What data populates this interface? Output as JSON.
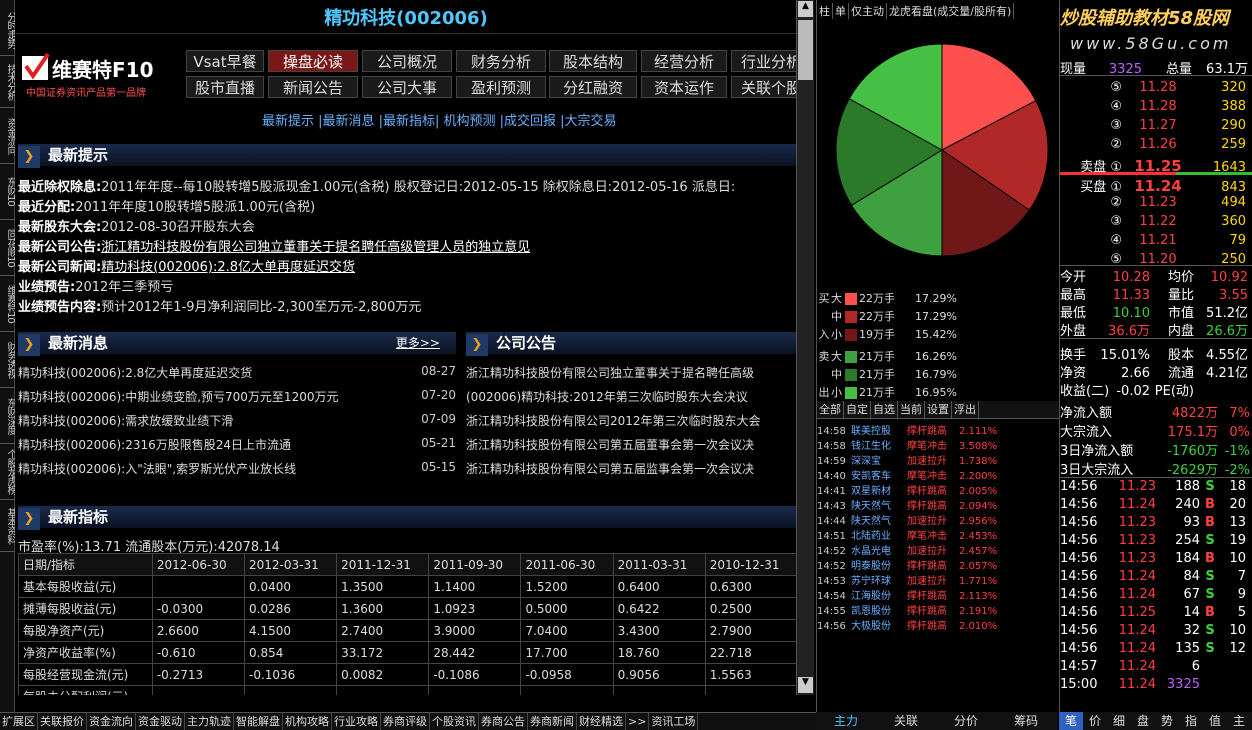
{
  "left_tabs": [
    "分时走势",
    "技术分析",
    "资金流向",
    "东财10",
    "同花顺10",
    "维赛特10",
    "财务透视",
    "东财深度",
    "个股龙虎榜",
    "基本资料"
  ],
  "title": "精功科技(002006)",
  "logo": {
    "name": "维赛特F10",
    "tagline": "中国证券资讯产品第一品牌"
  },
  "nav_row1": [
    "Vsat早餐",
    "操盘必读",
    "公司概况",
    "财务分析",
    "股本结构",
    "经营分析",
    "行业分析"
  ],
  "nav_row2": [
    "股市直播",
    "新闻公告",
    "公司大事",
    "盈利预测",
    "分红融资",
    "资本运作",
    "关联个股"
  ],
  "sublinks": "最新提示 |最新消息 |最新指标| 机构预测 |成交回报 |大宗交易",
  "sec_tips": "最新提示",
  "tips": [
    {
      "k": "最近除权除息:",
      "v": "2011年年度--每10股转增5股派现金1.00元(含税) 股权登记日:2012-05-15 除权除息日:2012-05-16 派息日:"
    },
    {
      "k": "最近分配:",
      "v": "2011年年度10股转增5股派1.00元(含税)"
    },
    {
      "k": "最新股东大会:",
      "v": "2012-08-30召开股东大会"
    },
    {
      "k": "最新公司公告:",
      "v": "浙江精功科技股份有限公司独立董事关于提名聘任高级管理人员的独立意见"
    },
    {
      "k": "最新公司新闻:",
      "v": "精功科技(002006):2.8亿大单再度延迟交货"
    },
    {
      "k": "业绩预告:",
      "v": "2012年三季预亏"
    },
    {
      "k": "业绩预告内容:",
      "v": "预计2012年1-9月净利润同比-2,300至万元-2,800万元"
    }
  ],
  "sec_news": "最新消息",
  "more": "更多>>",
  "sec_ann": "公司公告",
  "news": [
    {
      "t": "精功科技(002006):2.8亿大单再度延迟交货",
      "d": "08-27"
    },
    {
      "t": "精功科技(002006):中期业绩变脸,预亏700万元至1200万元",
      "d": "07-20"
    },
    {
      "t": "精功科技(002006):需求放缓致业绩下滑",
      "d": "07-09"
    },
    {
      "t": "精功科技(002006):2316万股限售股24日上市流通",
      "d": "05-21"
    },
    {
      "t": "精功科技(002006):入\"法眼\",索罗斯光伏产业放长线",
      "d": "05-15"
    }
  ],
  "announcements": [
    "浙江精功科技股份有限公司独立董事关于提名聘任高级",
    "(002006)精功科技:2012年第三次临时股东大会决议",
    "浙江精功科技股份有限公司2012年第三次临时股东大会",
    "浙江精功科技股份有限公司第五届董事会第一次会议决",
    "浙江精功科技股份有限公司第五届监事会第一次会议决"
  ],
  "sec_ind": "最新指标",
  "ind_summary": "市盈率(%):13.71  流通股本(万元):42078.14",
  "ind_header": [
    "日期/指标",
    "2012-06-30",
    "2012-03-31",
    "2011-12-31",
    "2011-09-30",
    "2011-06-30",
    "2011-03-31",
    "2010-12-31"
  ],
  "ind_rows": [
    [
      "基本每股收益(元)",
      "",
      "0.0400",
      "1.3500",
      "1.1400",
      "1.5200",
      "0.6400",
      "0.6300"
    ],
    [
      "摊薄每股收益(元)",
      "-0.0300",
      "0.0286",
      "1.3600",
      "1.0923",
      "0.5000",
      "0.6422",
      "0.2500"
    ],
    [
      "每股净资产(元)",
      "2.6600",
      "4.1500",
      "2.7400",
      "3.9000",
      "7.0400",
      "3.4300",
      "2.7900"
    ],
    [
      "净资产收益率(%)",
      "-0.610",
      "0.854",
      "33.172",
      "28.442",
      "17.700",
      "18.760",
      "22.718"
    ],
    [
      "每股经营现金流(元)",
      "-0.2713",
      "-0.1036",
      "0.0082",
      "-0.1086",
      "-0.0958",
      "0.9056",
      "1.5563"
    ],
    [
      "每股未分配利润(元)",
      "",
      "",
      "",
      "",
      "",
      "",
      ""
    ]
  ],
  "mid_tabs": [
    "柱",
    "单",
    "仅主动",
    "龙虎看盘(成交量/股所有)"
  ],
  "pie": {
    "slices": [
      {
        "label": "买大",
        "pct": 17.29,
        "color": "#ff5050"
      },
      {
        "label": "买中",
        "pct": 17.29,
        "color": "#b02828"
      },
      {
        "label": "买小",
        "pct": 15.42,
        "color": "#701818"
      },
      {
        "label": "卖大",
        "pct": 16.26,
        "color": "#3fa03f"
      },
      {
        "label": "卖中",
        "pct": 16.79,
        "color": "#2a7a2a"
      },
      {
        "label": "卖小",
        "pct": 16.95,
        "color": "#45c045"
      }
    ]
  },
  "fund_flow": [
    {
      "side": "买",
      "size": "大",
      "val": "22万手",
      "pct": "17.29%",
      "color": "#ff5050"
    },
    {
      "side": "",
      "size": "中",
      "val": "22万手",
      "pct": "17.29%",
      "color": "#b02828"
    },
    {
      "side": "入",
      "size": "小",
      "val": "19万手",
      "pct": "15.42%",
      "color": "#701818"
    },
    {
      "side": "卖",
      "size": "大",
      "val": "21万手",
      "pct": "16.26%",
      "color": "#3fa03f"
    },
    {
      "side": "",
      "size": "中",
      "val": "21万手",
      "pct": "16.79%",
      "color": "#2a7a2a"
    },
    {
      "side": "出",
      "size": "小",
      "val": "21万手",
      "pct": "16.95%",
      "color": "#45c045"
    }
  ],
  "list_tabs": [
    "全部",
    "自定",
    "自选",
    "当前",
    "设置",
    "浮出"
  ],
  "list": [
    {
      "t": "14:58",
      "n": "联美控股",
      "e": "撑杆跳高",
      "p": "2.111%"
    },
    {
      "t": "14:58",
      "n": "钱江生化",
      "e": "摩笔冲击",
      "p": "3.508%"
    },
    {
      "t": "14:59",
      "n": "深深宝",
      "e": "加速拉升",
      "p": "1.738%"
    },
    {
      "t": "14:40",
      "n": "安凯客车",
      "e": "摩笔冲击",
      "p": "2.200%"
    },
    {
      "t": "14:41",
      "n": "双星新材",
      "e": "撑杆跳高",
      "p": "2.005%"
    },
    {
      "t": "14:43",
      "n": "陕天然气",
      "e": "撑杆跳高",
      "p": "2.094%"
    },
    {
      "t": "14:44",
      "n": "陕天然气",
      "e": "加速拉升",
      "p": "2.956%"
    },
    {
      "t": "14:51",
      "n": "北陆药业",
      "e": "摩笔冲击",
      "p": "2.453%"
    },
    {
      "t": "14:52",
      "n": "水晶光电",
      "e": "加速拉升",
      "p": "2.457%"
    },
    {
      "t": "14:52",
      "n": "明泰股份",
      "e": "撑杆跳高",
      "p": "2.057%"
    },
    {
      "t": "14:53",
      "n": "苏宁环球",
      "e": "加速拉升",
      "p": "1.771%"
    },
    {
      "t": "14:54",
      "n": "江海股份",
      "e": "撑杆跳高",
      "p": "2.113%"
    },
    {
      "t": "14:55",
      "n": "凯恩股份",
      "e": "撑杆跳高",
      "p": "2.191%"
    },
    {
      "t": "14:56",
      "n": "大极股份",
      "e": "撑杆跳高",
      "p": "2.010%"
    }
  ],
  "mid_bottom": [
    "主力",
    "关联",
    "分价",
    "筹码"
  ],
  "brand": "炒股辅助教材58股网",
  "brand_url": "www.58Gu.com",
  "vol": {
    "now_label": "现量",
    "now": "3325",
    "total_label": "总量",
    "total": "63.1万"
  },
  "asks": [
    {
      "lvl": "⑤",
      "p": "11.28",
      "v": "320"
    },
    {
      "lvl": "④",
      "p": "11.28",
      "v": "388"
    },
    {
      "lvl": "③",
      "p": "11.27",
      "v": "290"
    },
    {
      "lvl": "②",
      "p": "11.26",
      "v": "259"
    },
    {
      "lvl": "卖盘 ①",
      "p": "11.25",
      "v": "1643"
    }
  ],
  "bids": [
    {
      "lvl": "买盘 ①",
      "p": "11.24",
      "v": "843"
    },
    {
      "lvl": "②",
      "p": "11.23",
      "v": "494"
    },
    {
      "lvl": "③",
      "p": "11.22",
      "v": "360"
    },
    {
      "lvl": "④",
      "p": "11.21",
      "v": "79"
    },
    {
      "lvl": "⑤",
      "p": "11.20",
      "v": "250"
    }
  ],
  "stats": [
    [
      "今开",
      "10.28",
      "均价",
      "10.92"
    ],
    [
      "最高",
      "11.33",
      "量比",
      "3.55"
    ],
    [
      "最低",
      "10.10",
      "市值",
      "51.2亿"
    ],
    [
      "外盘",
      "36.6万",
      "内盘",
      "26.6万"
    ],
    [
      "换手",
      "15.01%",
      "股本",
      "4.55亿"
    ],
    [
      "净资",
      "2.66",
      "流通",
      "4.21亿"
    ],
    [
      "收益(二)",
      "-0.02",
      "PE(动)",
      ""
    ]
  ],
  "flows": [
    {
      "k": "净流入额",
      "v": "4822万",
      "p": "7%"
    },
    {
      "k": "大宗流入",
      "v": "175.1万",
      "p": "0%"
    },
    {
      "k": "3日净流入额",
      "v": "-1760万",
      "p": "-1%"
    },
    {
      "k": "3日大宗流入",
      "v": "-2629万",
      "p": "-2%"
    }
  ],
  "ticks": [
    [
      "14:56",
      "11.23",
      "188",
      "S",
      "18"
    ],
    [
      "14:56",
      "11.24",
      "240",
      "B",
      "20"
    ],
    [
      "14:56",
      "11.23",
      "93",
      "B",
      "13"
    ],
    [
      "14:56",
      "11.23",
      "254",
      "S",
      "19"
    ],
    [
      "14:56",
      "11.23",
      "184",
      "B",
      "10"
    ],
    [
      "14:56",
      "11.24",
      "84",
      "S",
      "7"
    ],
    [
      "14:56",
      "11.24",
      "67",
      "S",
      "9"
    ],
    [
      "14:56",
      "11.25",
      "14",
      "B",
      "5"
    ],
    [
      "14:56",
      "11.24",
      "32",
      "S",
      "10"
    ],
    [
      "14:56",
      "11.24",
      "135",
      "S",
      "12"
    ],
    [
      "14:57",
      "11.24",
      "6",
      "",
      ""
    ],
    [
      "15:00",
      "11.24",
      "3325",
      "",
      ""
    ]
  ],
  "right_bottom": [
    "笔",
    "价",
    "细",
    "盘",
    "势",
    "指",
    "值",
    "主"
  ],
  "bottom_bar": [
    "扩展区",
    "关联报价",
    "资金流向",
    "资金驱动",
    "主力轨迹",
    "智能解盘",
    "机构攻略",
    "行业攻略",
    "券商评级",
    "个股资讯",
    "券商公告",
    "券商新闻",
    "财经精选",
    ">>",
    "资讯工场"
  ]
}
